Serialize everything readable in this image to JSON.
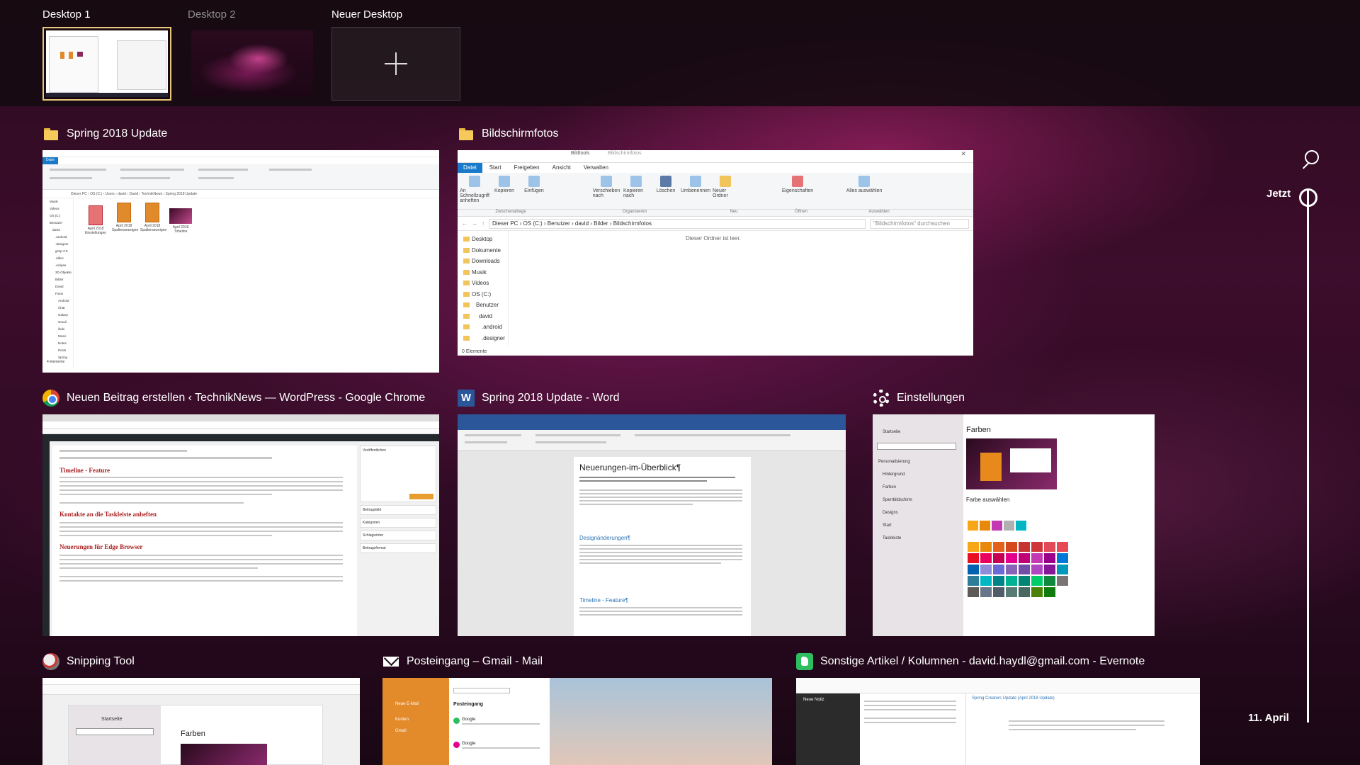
{
  "desktops": [
    {
      "label": "Desktop 1",
      "active": true
    },
    {
      "label": "Desktop 2",
      "active": false
    },
    {
      "label": "Neuer Desktop",
      "active": false
    }
  ],
  "windows": {
    "spring_explorer": {
      "title": "Spring 2018 Update",
      "icon": "folder-icon",
      "tree": [
        "Musik",
        "Videos",
        "OS (C:)",
        "Benutzer",
        "david",
        ".android",
        ".designer",
        "gimp-2.8",
        ".idlerc",
        ".eclipse",
        "3D-Objekte",
        "Bilder",
        "David",
        "Fotos",
        "Android",
        "Chat",
        "Galaxy",
        "Gmail",
        "ibuki",
        "Music",
        "Notes",
        "Posts",
        "Spring"
      ],
      "files": [
        "April 2018 Einstellungen",
        "April 2018 Spaltenanzeigen",
        "April 2018 Spaltenanzeigen",
        "April 2018 Timeline"
      ],
      "address": "Dieser PC › OS (C:) › Users › david › David › TechnikNews › Spring 2018 Update",
      "status": "4 Elemente"
    },
    "bildschirmfotos": {
      "title": "Bildschirmfotos",
      "icon": "folder-icon",
      "window_title": "Bildschirmfotos",
      "ribbon_tabs": [
        "Datei",
        "Start",
        "Freigeben",
        "Ansicht",
        "Verwalten"
      ],
      "ribbon_context": "Bildtools",
      "ribbon_buttons": [
        "An Schnellzugriff anheften",
        "Kopieren",
        "Einfügen",
        "Verschieben nach",
        "Kopieren nach",
        "Löschen",
        "Umbenennen",
        "Neuer Ordner",
        "Eigenschaften",
        "Alles auswählen"
      ],
      "ribbon_groups": [
        "Zwischenablage",
        "Organisieren",
        "Neu",
        "Öffnen",
        "Auswählen"
      ],
      "address": "Dieser PC › OS (C:) › Benutzer › david › Bilder › Bildschirmfotos",
      "search_placeholder": "\"Bildschirmfotos\" durchsuchen",
      "tree": [
        "Desktop",
        "Dokumente",
        "Downloads",
        "Musik",
        "Videos",
        "OS (C:)",
        "Benutzer",
        "david",
        ".android",
        ".designer"
      ],
      "empty_text": "Dieser Ordner ist leer.",
      "status": "0 Elemente"
    },
    "chrome": {
      "title": "Neuen Beitrag erstellen ‹ TechnikNews — WordPress - Google Chrome",
      "icon": "chrome-icon",
      "headings": [
        "Timeline - Feature",
        "Kontakte an die Taskleiste anheften",
        "Neuerungen für Edge Browser"
      ],
      "sidebar": [
        "Veröffentlichen",
        "Beitragsbild",
        "Kategorien",
        "Schlagwörter",
        "Beitragsformat"
      ]
    },
    "word": {
      "title": "Spring 2018 Update - Word",
      "icon": "word-icon",
      "heading": "Neuerungen-im-Überblick¶",
      "sections": [
        "Designänderungen¶",
        "Timeline - Feature¶"
      ]
    },
    "settings": {
      "title": "Einstellungen",
      "icon": "gear-icon",
      "page_heading": "Farben",
      "section": "Farbe auswählen",
      "nav": [
        "Startseite",
        "Personalisierung",
        "Hintergrund",
        "Farben",
        "Sperrbildschirm",
        "Designs",
        "Start",
        "Taskleiste"
      ],
      "swatches": [
        "#f7a616",
        "#e8890b",
        "#e2621c",
        "#d44a1d",
        "#c73330",
        "#d13438",
        "#e24a58",
        "#e74856",
        "#e81123",
        "#ea005e",
        "#c30052",
        "#e3008c",
        "#bf0077",
        "#c239b3",
        "#9a0089",
        "#0078d7",
        "#0063b1",
        "#8e8cd8",
        "#6b69d6",
        "#8764b8",
        "#744da9",
        "#b146c2",
        "#881798",
        "#0099bc",
        "#2d7d9a",
        "#00b7c3",
        "#038387",
        "#00b294",
        "#018574",
        "#00cc6a",
        "#10893e",
        "#7a7574",
        "#5d5a58",
        "#68768a",
        "#515c6b",
        "#567c73",
        "#486860",
        "#498205",
        "#107c10"
      ],
      "recent": [
        "#f7a616",
        "#e8890b",
        "#c239b3",
        "#b0b0b0",
        "#00b7c3"
      ]
    },
    "snipping": {
      "title": "Snipping Tool",
      "icon": "snipping-icon",
      "inner_heading": "Farben",
      "inner_nav": "Startseite"
    },
    "mail": {
      "title": "Posteingang – Gmail - Mail",
      "icon": "mail-icon",
      "nav": [
        "Neue E-Mail",
        "Konten",
        "Gmail"
      ],
      "list_title": "Posteingang",
      "items": [
        "Google",
        "Google"
      ]
    },
    "evernote": {
      "title": "Sonstige Artikel / Kolumnen - david.haydl@gmail.com - Evernote",
      "icon": "evernote-icon",
      "note_title": "Spring Creators Update (April 2018 Update)",
      "new_note": "Neue Notiz"
    }
  },
  "timeline": {
    "now_label": "Jetzt",
    "date_label": "11. April"
  }
}
